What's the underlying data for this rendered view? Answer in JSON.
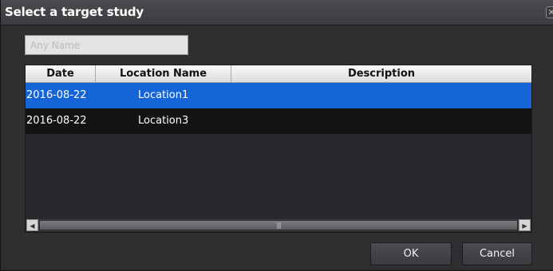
{
  "dialog": {
    "title": "Select a target study",
    "close_symbol": "✕"
  },
  "search": {
    "placeholder": "Any Name",
    "value": ""
  },
  "table": {
    "columns": [
      "Date",
      "Location Name",
      "Description"
    ],
    "rows": [
      {
        "date": "2016-08-22",
        "location": "Location1",
        "description": "",
        "selected": true
      },
      {
        "date": "2016-08-22",
        "location": "Location3",
        "description": "",
        "selected": false
      }
    ],
    "scroll_grip": "|||"
  },
  "buttons": {
    "ok_label": "OK",
    "cancel_label": "Cancel"
  },
  "colors": {
    "selected_row": "#1565d8",
    "dialog_bg": "#2e2f31"
  },
  "icons": {
    "close": "close-icon",
    "scroll_left": "scroll-left-arrow-icon",
    "scroll_right": "scroll-right-arrow-icon"
  }
}
